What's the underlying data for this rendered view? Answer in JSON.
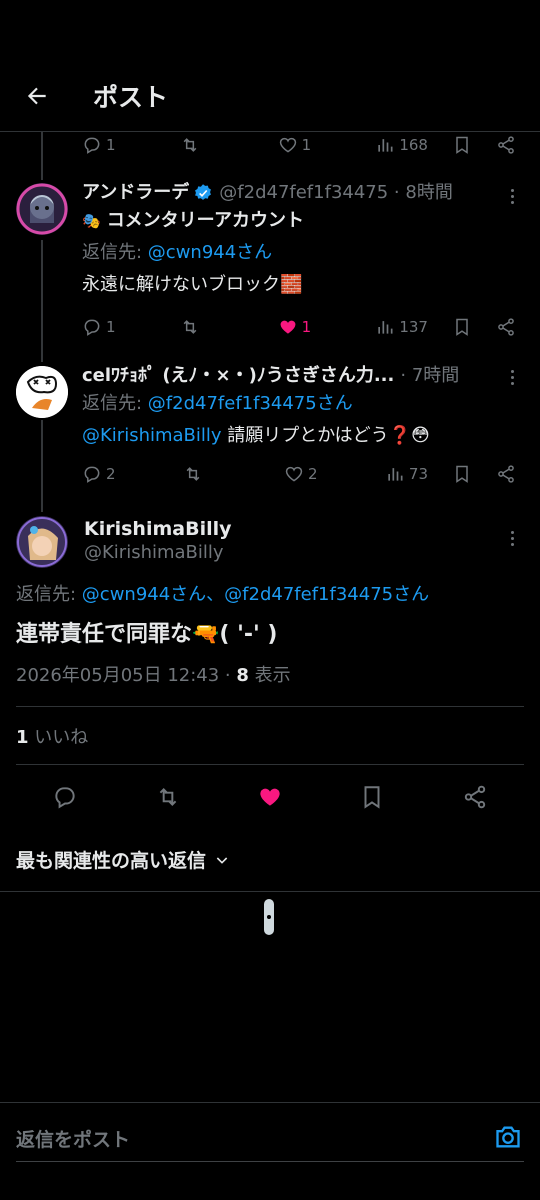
{
  "header": {
    "title": "ポスト"
  },
  "top_actions": {
    "replies": "1",
    "likes": "1",
    "views": "168"
  },
  "reply1": {
    "name": "アンドラーデ",
    "handle_meta": "@f2d47fef1f34475 · 8時間",
    "badge_emoji": "🎭",
    "badge_text": "コメンタリーアカウント",
    "reply_to_prefix": "返信先: ",
    "reply_to_handle": "@cwn944さん",
    "body": "永遠に解けないブロック🧱",
    "replies": "1",
    "likes": "1",
    "views": "137"
  },
  "reply2": {
    "name": "celﾜﾁｮﾎﾟ (えﾉ・×・)ﾉうさぎさん力...",
    "handle_meta": "· 7時間",
    "reply_to_prefix": "返信先: ",
    "reply_to_handle": "@f2d47fef1f34475さん",
    "body_mention": "@KirishimaBilly",
    "body_text": " 請願リプとかはどう❓😳",
    "replies": "2",
    "likes": "2",
    "views": "73"
  },
  "main": {
    "name": "KirishimaBilly",
    "handle": "@KirishimaBilly",
    "reply_to_prefix": "返信先: ",
    "reply_to_handles": "@cwn944さん、@f2d47fef1f34475さん",
    "body": "連帯責任で同罪な🔫( '-' )",
    "timestamp": "2026年05月05日 12:43 · ",
    "views_count": "8",
    "views_label": " 表示",
    "likes_count": "1",
    "likes_label": " いいね"
  },
  "sort": {
    "label": "最も関連性の高い返信"
  },
  "compose": {
    "placeholder": "返信をポスト"
  },
  "colors": {
    "accent": "#1d9bf0",
    "like": "#f91880",
    "muted": "#71767b",
    "bg": "#000000"
  }
}
